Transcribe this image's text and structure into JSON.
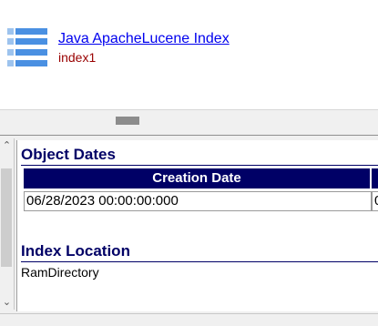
{
  "header": {
    "title_link": "Java ApacheLucene Index",
    "subtitle": "index1"
  },
  "icons": {
    "header_icon": "list-icon",
    "scroll_up": "chevron-up-icon",
    "scroll_down": "chevron-down-icon"
  },
  "object_dates": {
    "heading": "Object Dates",
    "columns": [
      "Creation Date",
      ""
    ],
    "rows": [
      [
        "06/28/2023 00:00:00:000",
        "0"
      ]
    ]
  },
  "index_location": {
    "heading": "Index Location",
    "value": "RamDirectory"
  },
  "colors": {
    "heading": "#000066",
    "link": "#0000ee",
    "subtitle": "#990000",
    "icon": "#4a90e2"
  }
}
